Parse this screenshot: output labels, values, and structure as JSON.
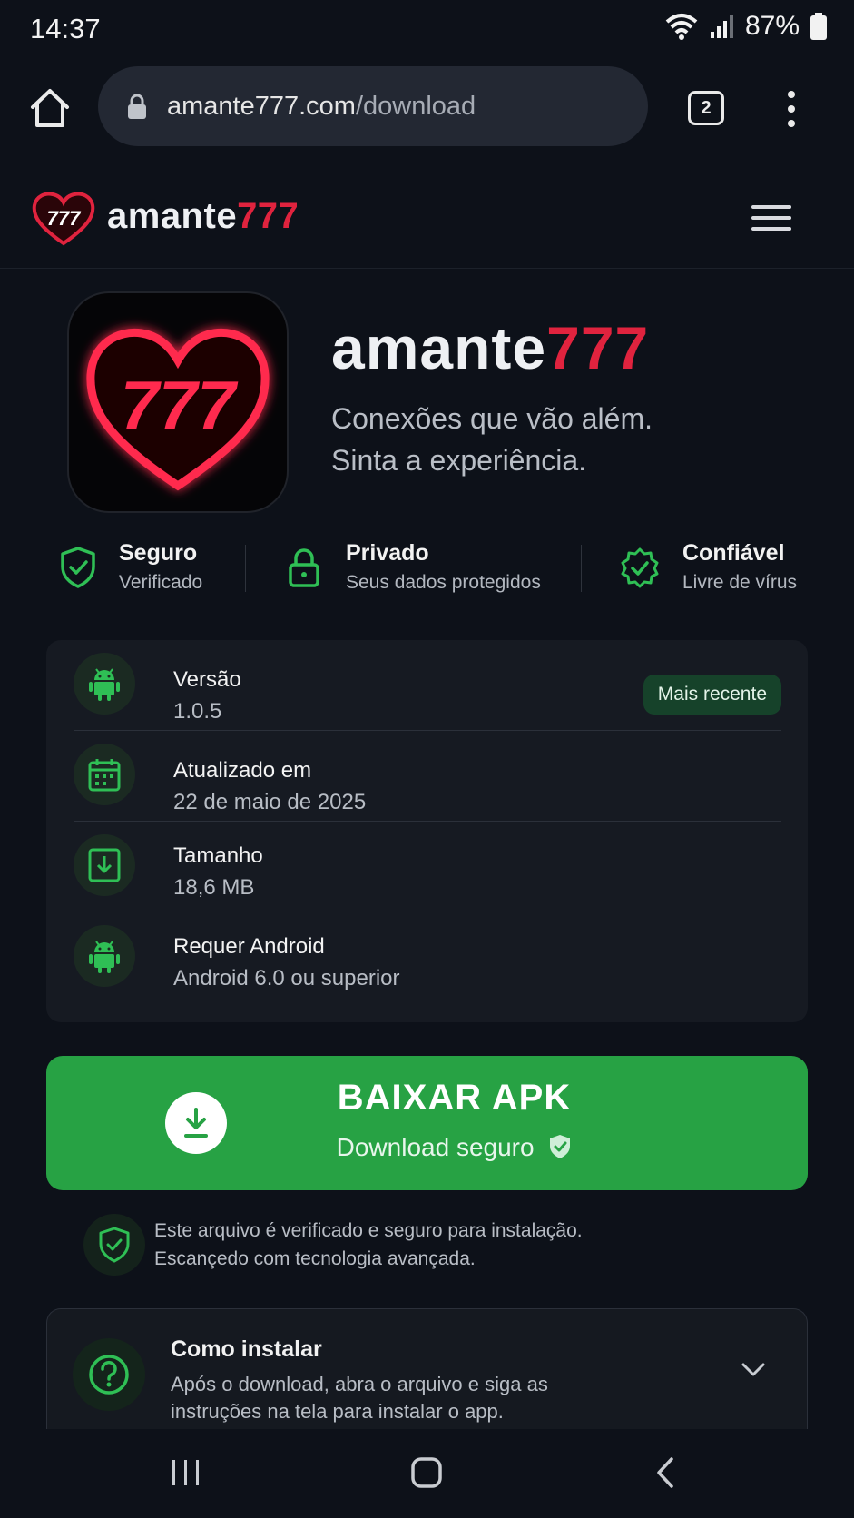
{
  "status_bar": {
    "time": "14:37",
    "battery": "87%"
  },
  "browser": {
    "url_domain": "amante777.com",
    "url_path": "/download",
    "tab_count": "2"
  },
  "site": {
    "logo_word": "amante",
    "logo_num": "777",
    "icon_num": "777"
  },
  "hero": {
    "title_word": "amante",
    "title_num": "777",
    "tagline_1": "Conexões que vão além.",
    "tagline_2": "Sinta a experiência."
  },
  "trust": [
    {
      "title": "Seguro",
      "desc": "Verificado",
      "icon": "shield-check-icon"
    },
    {
      "title": "Privado",
      "desc": "Seus dados protegidos",
      "icon": "lock-icon"
    },
    {
      "title": "Confiável",
      "desc": "Livre de vírus",
      "icon": "badge-check-icon"
    }
  ],
  "info": [
    {
      "label": "Versão",
      "value": "1.0.5",
      "icon": "android-icon"
    },
    {
      "label": "Atualizado em",
      "value": "22 de maio de 2025",
      "icon": "calendar-icon"
    },
    {
      "label": "Tamanho",
      "value": "18,6 MB",
      "icon": "download-box-icon"
    },
    {
      "label": "Requer Android",
      "value": "Android 6.0 ou superior",
      "icon": "android-icon"
    }
  ],
  "version_badge": "Mais recente",
  "download": {
    "title": "BAIXAR APK",
    "subtitle": "Download seguro"
  },
  "security_note": {
    "line1": "Este arquivo é verificado e seguro para instalação.",
    "line2": "Escançedo com tecnologia avançada."
  },
  "install": {
    "title": "Como instalar",
    "desc1": "Após o download, abra o arquivo e siga as",
    "desc2": "instruções na tela para instalar o app."
  },
  "colors": {
    "accent_red": "#e0233e",
    "accent_green": "#27a244",
    "background": "#0d1119"
  }
}
